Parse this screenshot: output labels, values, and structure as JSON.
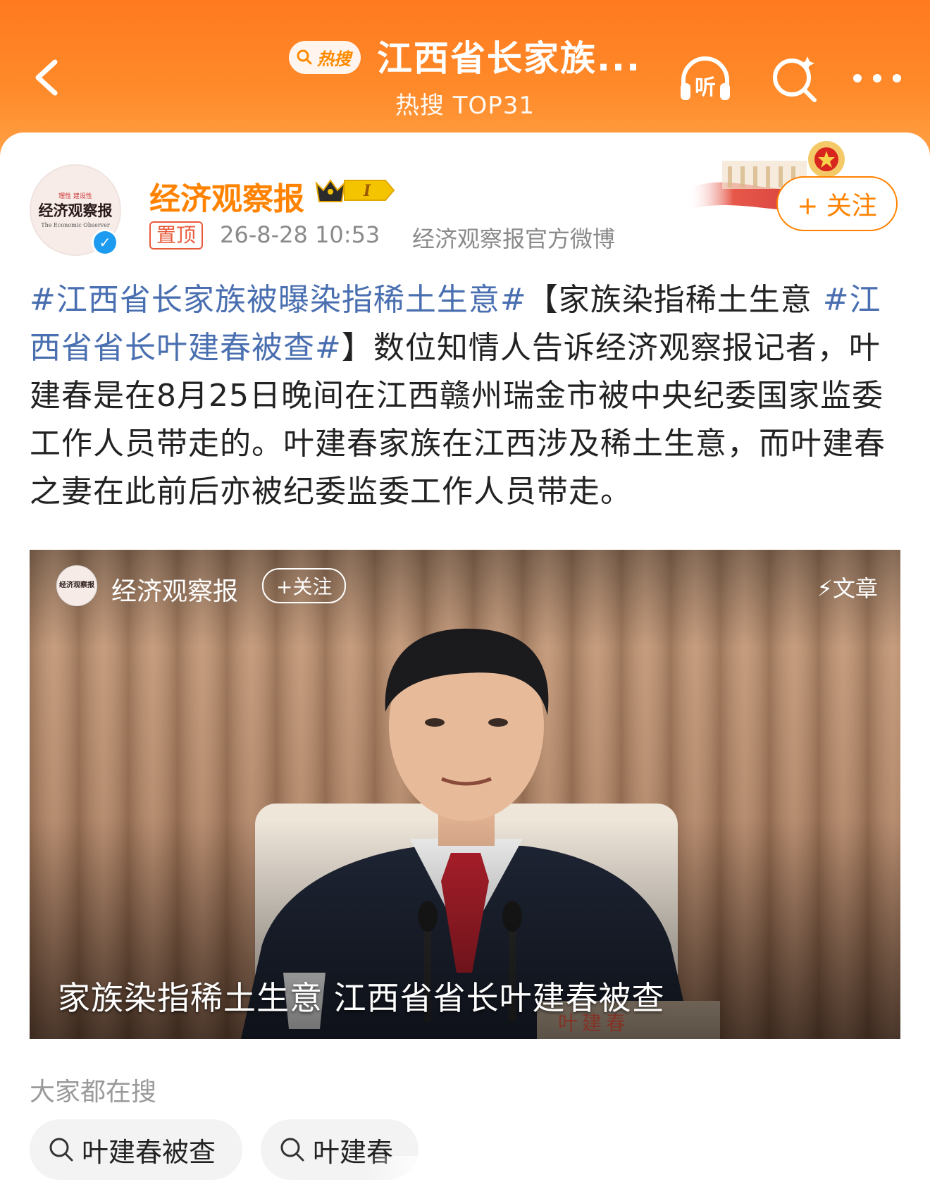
{
  "header": {
    "hot_search_label": "热搜",
    "title": "江西省长家族...",
    "subtitle": "热搜 TOP31",
    "listen_label": "听"
  },
  "post": {
    "author": "经济观察报",
    "author_level": "I",
    "avatar_logo_cn": "经济观察报",
    "avatar_logo_en": "The Economic Observer",
    "avatar_logo_top": "理性 建设性",
    "pin_label": "置顶",
    "time": "26-8-28 10:53",
    "source": "经济观察报官方微博",
    "follow_label": "+ 关注",
    "text": {
      "topic1": "#江西省长家族被曝染指稀土生意#",
      "part1": "【家族染指稀土生意 ",
      "topic2": "#江西省省长叶建春被查#",
      "part2": "】数位知情人告诉经济观察报记者，叶建春是在8月25日晚间在江西赣州瑞金市被中央纪委国家监委工作人员带走的。叶建春家族在江西涉及稀土生意，而叶建春之妻在此前后亦被纪委监委工作人员带走。"
    }
  },
  "video": {
    "author": "经济观察报",
    "avatar_text": "经济观察报",
    "follow_label": "+关注",
    "article_label": "⚡文章",
    "caption": "家族染指稀土生意 江西省省长叶建春被查",
    "nameplate": "叶建春"
  },
  "related": {
    "title": "大家都在搜",
    "chips": [
      {
        "label": "叶建春被查"
      },
      {
        "label": "叶建春"
      }
    ]
  },
  "colors": {
    "header_orange": "#ff7a1e",
    "accent": "#ff8200",
    "topic_blue": "#4a6fb0",
    "verify_blue": "#1d9bf0"
  }
}
